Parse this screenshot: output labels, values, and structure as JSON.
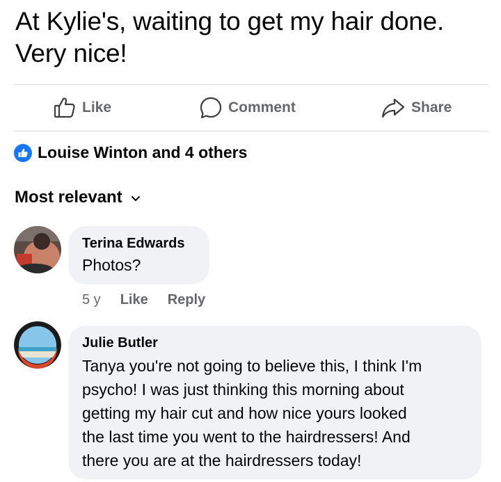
{
  "post": {
    "text_line1": "At Kylie's, waiting to get my hair done.",
    "text_line2": "Very nice!"
  },
  "actions": {
    "like": "Like",
    "comment": "Comment",
    "share": "Share"
  },
  "reactions": {
    "summary": "Louise Winton and 4 others",
    "icon": "like-thumb-icon",
    "color": "#1877f2"
  },
  "sort": {
    "label": "Most relevant",
    "icon": "chevron-down-icon"
  },
  "comments": [
    {
      "author": "Terina Edwards",
      "text": "Photos?",
      "age": "5 y",
      "like_label": "Like",
      "reply_label": "Reply"
    },
    {
      "author": "Julie Butler",
      "text_lines": [
        "Tanya you're not going to believe this, I think I'm",
        "psycho! I was just thinking this morning about",
        "getting my hair cut and how nice yours looked",
        "the last time you went to the hairdressers! And",
        "there you are at the hairdressers today!"
      ]
    }
  ],
  "colors": {
    "bubble": "#f0f2f5",
    "secondary_text": "#65676b",
    "divider": "#dcdee2"
  }
}
